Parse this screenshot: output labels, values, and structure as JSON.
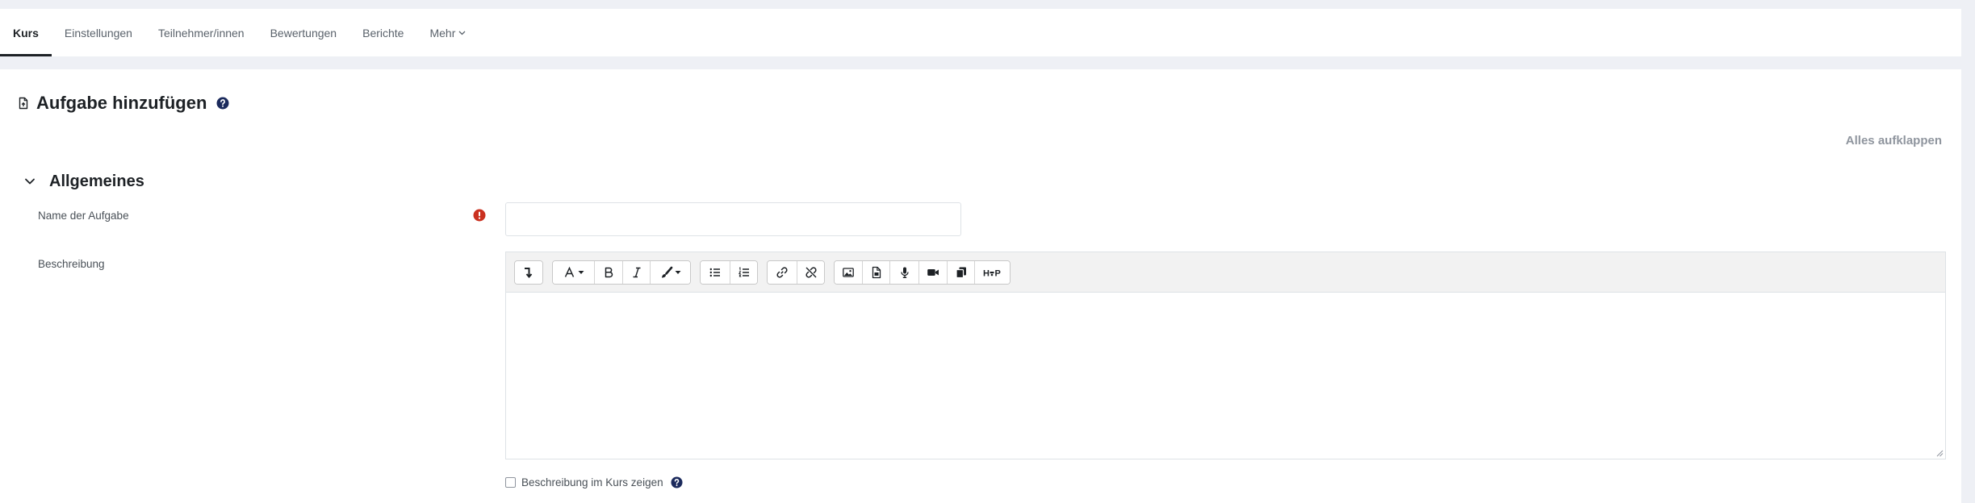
{
  "nav": {
    "tabs": [
      {
        "label": "Kurs",
        "active": true
      },
      {
        "label": "Einstellungen",
        "active": false
      },
      {
        "label": "Teilnehmer/innen",
        "active": false
      },
      {
        "label": "Bewertungen",
        "active": false
      },
      {
        "label": "Berichte",
        "active": false
      },
      {
        "label": "Mehr",
        "active": false,
        "dropdown": true
      }
    ]
  },
  "page": {
    "title": "Aufgabe hinzufügen",
    "expand_all": "Alles aufklappen"
  },
  "section": {
    "title": "Allgemeines",
    "expanded": true
  },
  "form": {
    "name": {
      "label": "Name der Aufgabe",
      "value": "",
      "required": true
    },
    "description": {
      "label": "Beschreibung"
    },
    "show_in_course": {
      "label": "Beschreibung im Kurs zeigen",
      "checked": false
    }
  },
  "editor": {
    "content": "",
    "toolbar_groups": [
      [
        {
          "icon": "show-more-icon"
        }
      ],
      [
        {
          "icon": "font-style-icon",
          "dropdown": true
        },
        {
          "icon": "bold-icon"
        },
        {
          "icon": "italic-icon"
        },
        {
          "icon": "paint-brush-icon",
          "dropdown": true
        }
      ],
      [
        {
          "icon": "unordered-list-icon"
        },
        {
          "icon": "ordered-list-icon"
        }
      ],
      [
        {
          "icon": "link-icon"
        },
        {
          "icon": "unlink-icon"
        }
      ],
      [
        {
          "icon": "image-icon"
        },
        {
          "icon": "media-file-icon"
        },
        {
          "icon": "microphone-icon"
        },
        {
          "icon": "video-icon"
        },
        {
          "icon": "manage-files-icon"
        },
        {
          "icon": "h5p-icon",
          "logo_text": "H5P"
        }
      ]
    ]
  },
  "icons": {
    "title": "assignment-icon",
    "help": "help-icon",
    "required": "required-icon",
    "section_toggle": "chevron-down-icon",
    "more_dropdown": "chevron-down-icon"
  },
  "colors": {
    "page_bg": "#eef0f5",
    "text": "#1d2125",
    "muted": "#5a626b",
    "help": "#1b2a5c",
    "required": "#ca3120"
  }
}
